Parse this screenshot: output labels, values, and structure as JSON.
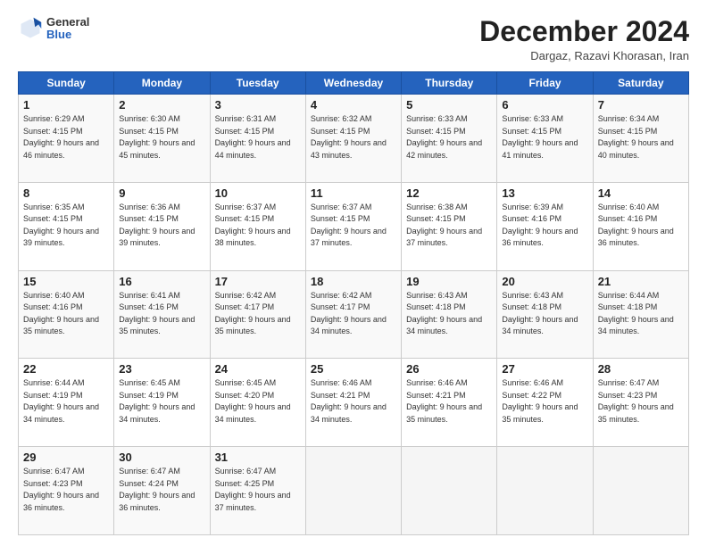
{
  "header": {
    "logo": {
      "general": "General",
      "blue": "Blue"
    },
    "title": "December 2024",
    "subtitle": "Dargaz, Razavi Khorasan, Iran"
  },
  "days_of_week": [
    "Sunday",
    "Monday",
    "Tuesday",
    "Wednesday",
    "Thursday",
    "Friday",
    "Saturday"
  ],
  "weeks": [
    [
      {
        "day": 1,
        "sunrise": "6:29 AM",
        "sunset": "4:15 PM",
        "daylight": "9 hours and 46 minutes."
      },
      {
        "day": 2,
        "sunrise": "6:30 AM",
        "sunset": "4:15 PM",
        "daylight": "9 hours and 45 minutes."
      },
      {
        "day": 3,
        "sunrise": "6:31 AM",
        "sunset": "4:15 PM",
        "daylight": "9 hours and 44 minutes."
      },
      {
        "day": 4,
        "sunrise": "6:32 AM",
        "sunset": "4:15 PM",
        "daylight": "9 hours and 43 minutes."
      },
      {
        "day": 5,
        "sunrise": "6:33 AM",
        "sunset": "4:15 PM",
        "daylight": "9 hours and 42 minutes."
      },
      {
        "day": 6,
        "sunrise": "6:33 AM",
        "sunset": "4:15 PM",
        "daylight": "9 hours and 41 minutes."
      },
      {
        "day": 7,
        "sunrise": "6:34 AM",
        "sunset": "4:15 PM",
        "daylight": "9 hours and 40 minutes."
      }
    ],
    [
      {
        "day": 8,
        "sunrise": "6:35 AM",
        "sunset": "4:15 PM",
        "daylight": "9 hours and 39 minutes."
      },
      {
        "day": 9,
        "sunrise": "6:36 AM",
        "sunset": "4:15 PM",
        "daylight": "9 hours and 39 minutes."
      },
      {
        "day": 10,
        "sunrise": "6:37 AM",
        "sunset": "4:15 PM",
        "daylight": "9 hours and 38 minutes."
      },
      {
        "day": 11,
        "sunrise": "6:37 AM",
        "sunset": "4:15 PM",
        "daylight": "9 hours and 37 minutes."
      },
      {
        "day": 12,
        "sunrise": "6:38 AM",
        "sunset": "4:15 PM",
        "daylight": "9 hours and 37 minutes."
      },
      {
        "day": 13,
        "sunrise": "6:39 AM",
        "sunset": "4:16 PM",
        "daylight": "9 hours and 36 minutes."
      },
      {
        "day": 14,
        "sunrise": "6:40 AM",
        "sunset": "4:16 PM",
        "daylight": "9 hours and 36 minutes."
      }
    ],
    [
      {
        "day": 15,
        "sunrise": "6:40 AM",
        "sunset": "4:16 PM",
        "daylight": "9 hours and 35 minutes."
      },
      {
        "day": 16,
        "sunrise": "6:41 AM",
        "sunset": "4:16 PM",
        "daylight": "9 hours and 35 minutes."
      },
      {
        "day": 17,
        "sunrise": "6:42 AM",
        "sunset": "4:17 PM",
        "daylight": "9 hours and 35 minutes."
      },
      {
        "day": 18,
        "sunrise": "6:42 AM",
        "sunset": "4:17 PM",
        "daylight": "9 hours and 34 minutes."
      },
      {
        "day": 19,
        "sunrise": "6:43 AM",
        "sunset": "4:18 PM",
        "daylight": "9 hours and 34 minutes."
      },
      {
        "day": 20,
        "sunrise": "6:43 AM",
        "sunset": "4:18 PM",
        "daylight": "9 hours and 34 minutes."
      },
      {
        "day": 21,
        "sunrise": "6:44 AM",
        "sunset": "4:18 PM",
        "daylight": "9 hours and 34 minutes."
      }
    ],
    [
      {
        "day": 22,
        "sunrise": "6:44 AM",
        "sunset": "4:19 PM",
        "daylight": "9 hours and 34 minutes."
      },
      {
        "day": 23,
        "sunrise": "6:45 AM",
        "sunset": "4:19 PM",
        "daylight": "9 hours and 34 minutes."
      },
      {
        "day": 24,
        "sunrise": "6:45 AM",
        "sunset": "4:20 PM",
        "daylight": "9 hours and 34 minutes."
      },
      {
        "day": 25,
        "sunrise": "6:46 AM",
        "sunset": "4:21 PM",
        "daylight": "9 hours and 34 minutes."
      },
      {
        "day": 26,
        "sunrise": "6:46 AM",
        "sunset": "4:21 PM",
        "daylight": "9 hours and 35 minutes."
      },
      {
        "day": 27,
        "sunrise": "6:46 AM",
        "sunset": "4:22 PM",
        "daylight": "9 hours and 35 minutes."
      },
      {
        "day": 28,
        "sunrise": "6:47 AM",
        "sunset": "4:23 PM",
        "daylight": "9 hours and 35 minutes."
      }
    ],
    [
      {
        "day": 29,
        "sunrise": "6:47 AM",
        "sunset": "4:23 PM",
        "daylight": "9 hours and 36 minutes."
      },
      {
        "day": 30,
        "sunrise": "6:47 AM",
        "sunset": "4:24 PM",
        "daylight": "9 hours and 36 minutes."
      },
      {
        "day": 31,
        "sunrise": "6:47 AM",
        "sunset": "4:25 PM",
        "daylight": "9 hours and 37 minutes."
      },
      null,
      null,
      null,
      null
    ]
  ]
}
